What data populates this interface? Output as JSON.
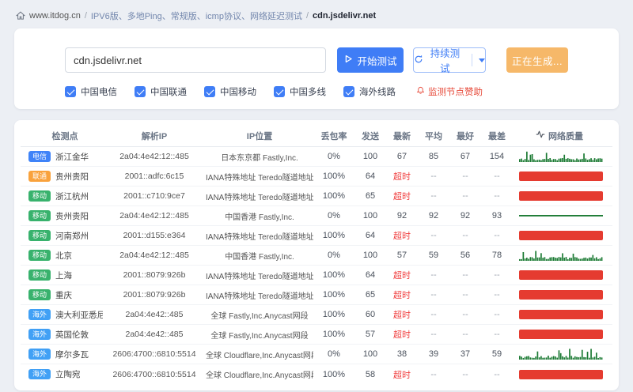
{
  "breadcrumb": {
    "site": "www.itdog.cn",
    "section": "IPV6版、多地Ping、常规版、icmp协议、网络延迟测试",
    "target": "cdn.jsdelivr.net"
  },
  "toolbar": {
    "host_input": "cdn.jsdelivr.net",
    "start_label": "开始测试",
    "continuous_label": "持续测试",
    "generating_label": "正在生成..."
  },
  "filters": {
    "checkboxes": [
      "中国电信",
      "中国联通",
      "中国移动",
      "中国多线",
      "海外线路"
    ],
    "sponsor_link": "监测节点赞助"
  },
  "table": {
    "headers": [
      "检测点",
      "解析IP",
      "IP位置",
      "丢包率",
      "发送",
      "最新",
      "平均",
      "最好",
      "最差",
      "网络质量"
    ],
    "rows": [
      {
        "badge": "电信",
        "badge_type": "telecom",
        "location": "浙江金华",
        "ip": "2a04:4e42:12::485",
        "ip_location": "日本东京都 Fastly,Inc.",
        "loss": "0%",
        "sent": "100",
        "latest": "67",
        "avg": "85",
        "best": "67",
        "worst": "154",
        "status": "ok",
        "profile": "spiky"
      },
      {
        "badge": "联通",
        "badge_type": "unicom",
        "location": "贵州贵阳",
        "ip": "2001::adfc:6c15",
        "ip_location": "IANA特殊地址 Teredo隧道地址",
        "loss": "100%",
        "sent": "64",
        "latest": "超时",
        "avg": "--",
        "best": "--",
        "worst": "--",
        "status": "timeout",
        "profile": ""
      },
      {
        "badge": "移动",
        "badge_type": "mobile",
        "location": "浙江杭州",
        "ip": "2001::c710:9ce7",
        "ip_location": "IANA特殊地址 Teredo隧道地址",
        "loss": "100%",
        "sent": "65",
        "latest": "超时",
        "avg": "--",
        "best": "--",
        "worst": "--",
        "status": "timeout",
        "profile": ""
      },
      {
        "badge": "移动",
        "badge_type": "mobile",
        "location": "贵州贵阳",
        "ip": "2a04:4e42:12::485",
        "ip_location": "中国香港 Fastly,Inc.",
        "loss": "0%",
        "sent": "100",
        "latest": "92",
        "avg": "92",
        "best": "92",
        "worst": "93",
        "status": "ok",
        "profile": "flat"
      },
      {
        "badge": "移动",
        "badge_type": "mobile",
        "location": "河南郑州",
        "ip": "2001::d155:e364",
        "ip_location": "IANA特殊地址 Teredo隧道地址",
        "loss": "100%",
        "sent": "64",
        "latest": "超时",
        "avg": "--",
        "best": "--",
        "worst": "--",
        "status": "timeout",
        "profile": ""
      },
      {
        "badge": "移动",
        "badge_type": "mobile",
        "location": "北京",
        "ip": "2a04:4e42:12::485",
        "ip_location": "中国香港 Fastly,Inc.",
        "loss": "0%",
        "sent": "100",
        "latest": "57",
        "avg": "59",
        "best": "56",
        "worst": "78",
        "status": "ok",
        "profile": "spiky"
      },
      {
        "badge": "移动",
        "badge_type": "mobile",
        "location": "上海",
        "ip": "2001::8079:926b",
        "ip_location": "IANA特殊地址 Teredo隧道地址",
        "loss": "100%",
        "sent": "64",
        "latest": "超时",
        "avg": "--",
        "best": "--",
        "worst": "--",
        "status": "timeout",
        "profile": ""
      },
      {
        "badge": "移动",
        "badge_type": "mobile",
        "location": "重庆",
        "ip": "2001::8079:926b",
        "ip_location": "IANA特殊地址 Teredo隧道地址",
        "loss": "100%",
        "sent": "65",
        "latest": "超时",
        "avg": "--",
        "best": "--",
        "worst": "--",
        "status": "timeout",
        "profile": ""
      },
      {
        "badge": "海外",
        "badge_type": "overseas",
        "location": "澳大利亚悉尼",
        "ip": "2a04:4e42::485",
        "ip_location": "全球 Fastly,Inc.Anycast网段",
        "loss": "100%",
        "sent": "60",
        "latest": "超时",
        "avg": "--",
        "best": "--",
        "worst": "--",
        "status": "timeout",
        "profile": ""
      },
      {
        "badge": "海外",
        "badge_type": "overseas",
        "location": "英国伦敦",
        "ip": "2a04:4e42::485",
        "ip_location": "全球 Fastly,Inc.Anycast网段",
        "loss": "100%",
        "sent": "57",
        "latest": "超时",
        "avg": "--",
        "best": "--",
        "worst": "--",
        "status": "timeout",
        "profile": ""
      },
      {
        "badge": "海外",
        "badge_type": "overseas",
        "location": "摩尔多瓦",
        "ip": "2606:4700::6810:5514",
        "ip_location": "全球 Cloudflare,Inc.Anycast网段",
        "loss": "0%",
        "sent": "100",
        "latest": "38",
        "avg": "39",
        "best": "37",
        "worst": "59",
        "status": "ok",
        "profile": "spiky"
      },
      {
        "badge": "海外",
        "badge_type": "overseas",
        "location": "立陶宛",
        "ip": "2606:4700::6810:5514",
        "ip_location": "全球 Cloudflare,Inc.Anycast网段",
        "loss": "100%",
        "sent": "58",
        "latest": "超时",
        "avg": "--",
        "best": "--",
        "worst": "--",
        "status": "timeout",
        "profile": ""
      }
    ]
  },
  "colors": {
    "telecom": "#3f83f8",
    "unicom": "#f9a23c",
    "mobile": "#38b26d",
    "overseas": "#41a0f5",
    "timeout_red": "#e53b30",
    "ok_green": "#1b7a33",
    "accent_blue": "#3f7df6"
  }
}
